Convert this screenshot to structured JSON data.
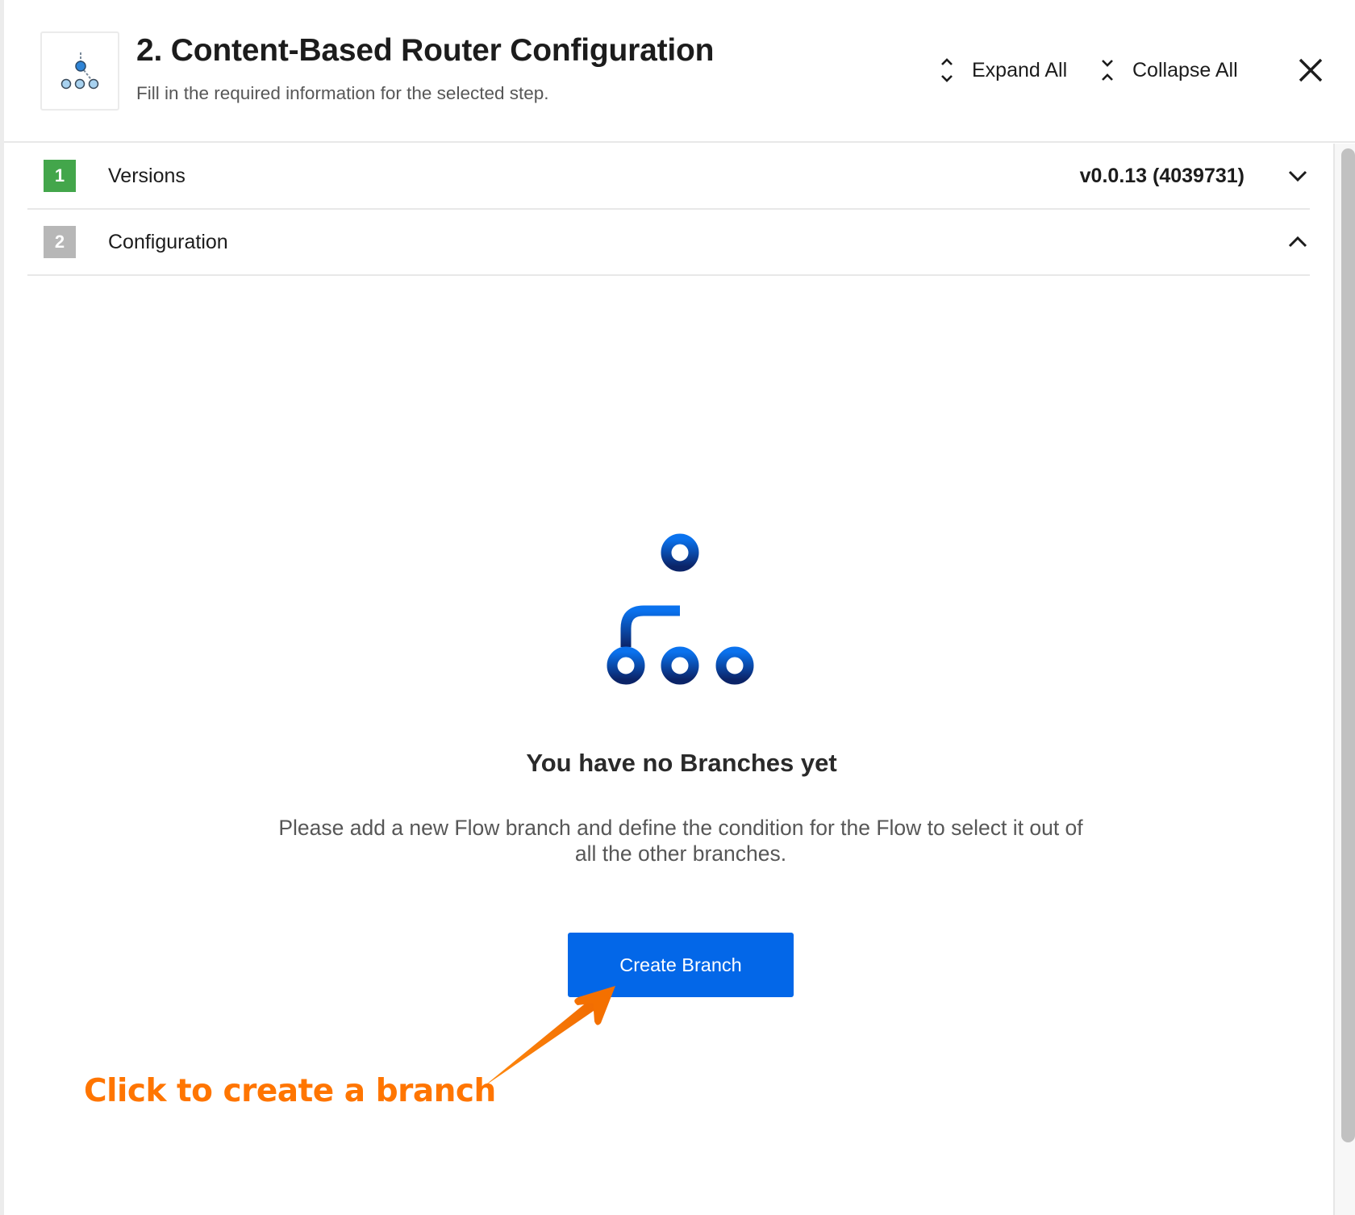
{
  "header": {
    "logo_icon": "content-based-router-icon",
    "title": "2. Content-Based Router Configuration",
    "subtitle": "Fill in the required information for the selected step.",
    "expand_all_label": "Expand All",
    "expand_all_icon": "expand-vertical-icon",
    "collapse_all_label": "Collapse All",
    "collapse_all_icon": "collapse-vertical-icon",
    "close_icon": "close-icon"
  },
  "steps": [
    {
      "number": "1",
      "label": "Versions",
      "value": "v0.0.13 (4039731)",
      "status": "complete",
      "expanded": false,
      "status_color": "#43a64b"
    },
    {
      "number": "2",
      "label": "Configuration",
      "value": "",
      "status": "pending",
      "expanded": true,
      "status_color": "#b7b7b7"
    }
  ],
  "empty_state": {
    "icon": "branches-icon",
    "title": "You have no Branches yet",
    "description": "Please add a new Flow branch and define the condition for the Flow to select it out of all the other branches.",
    "button_label": "Create Branch",
    "button_color": "#0367e8"
  },
  "annotation": {
    "text": "Click to create a branch",
    "color": "#ff7500"
  }
}
